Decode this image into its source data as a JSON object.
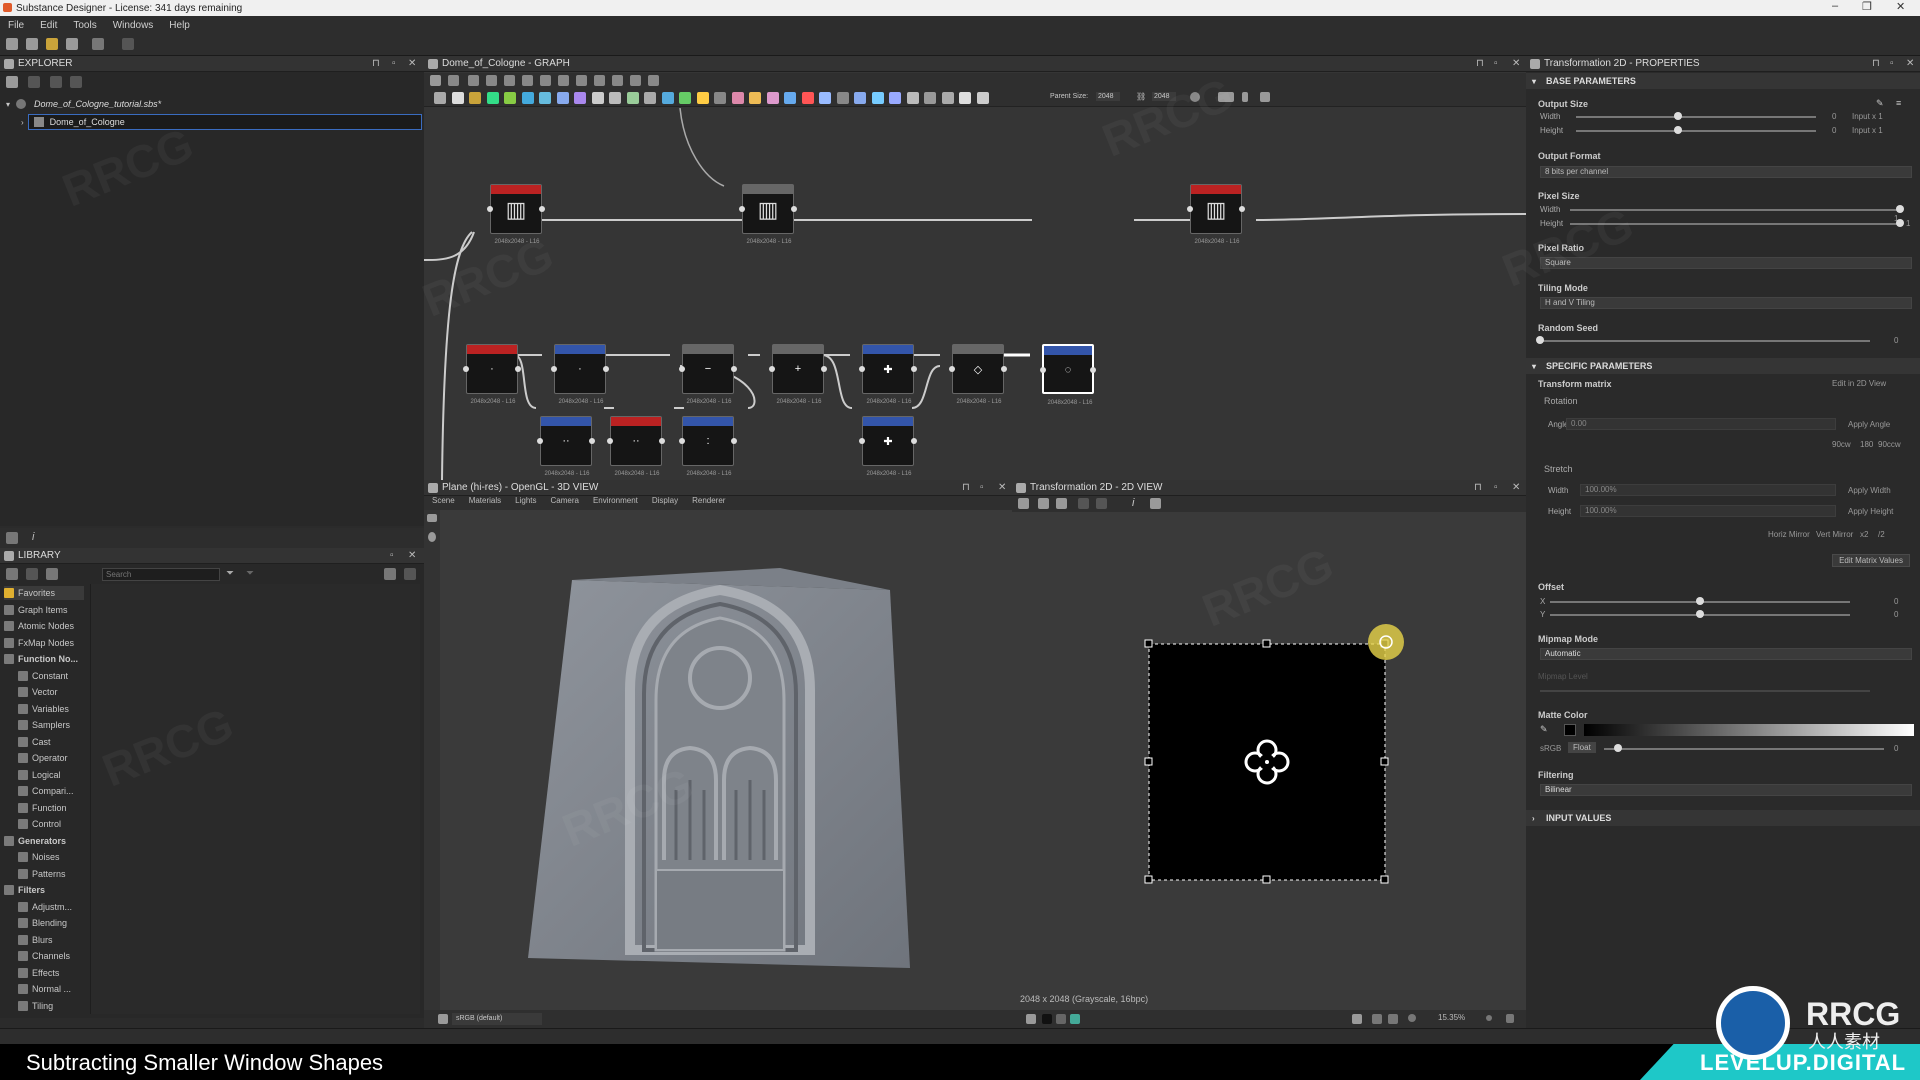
{
  "window": {
    "title": "Substance Designer - License: 341 days remaining",
    "controls": [
      "–",
      "❐",
      "✕"
    ]
  },
  "menu": [
    "File",
    "Edit",
    "Tools",
    "Windows",
    "Help"
  ],
  "explorer": {
    "title": "EXPLORER",
    "package": "Dome_of_Cologne_tutorial.sbs*",
    "graph_item": "Dome_of_Cologne"
  },
  "library": {
    "title": "LIBRARY",
    "search_placeholder": "Search",
    "categories": [
      {
        "label": "Favorites",
        "indent": 0
      },
      {
        "label": "Graph Items",
        "indent": 0
      },
      {
        "label": "Atomic Nodes",
        "indent": 0
      },
      {
        "label": "FxMap Nodes",
        "indent": 0
      },
      {
        "label": "Function No...",
        "indent": 0
      },
      {
        "label": "Constant",
        "indent": 1
      },
      {
        "label": "Vector",
        "indent": 1
      },
      {
        "label": "Variables",
        "indent": 1
      },
      {
        "label": "Samplers",
        "indent": 1
      },
      {
        "label": "Cast",
        "indent": 1
      },
      {
        "label": "Operator",
        "indent": 1
      },
      {
        "label": "Logical",
        "indent": 1
      },
      {
        "label": "Compari...",
        "indent": 1
      },
      {
        "label": "Function",
        "indent": 1
      },
      {
        "label": "Control",
        "indent": 1
      },
      {
        "label": "Generators",
        "indent": 0
      },
      {
        "label": "Noises",
        "indent": 1
      },
      {
        "label": "Patterns",
        "indent": 1
      },
      {
        "label": "Filters",
        "indent": 0
      },
      {
        "label": "Adjustm...",
        "indent": 1
      },
      {
        "label": "Blending",
        "indent": 1
      },
      {
        "label": "Blurs",
        "indent": 1
      },
      {
        "label": "Channels",
        "indent": 1
      },
      {
        "label": "Effects",
        "indent": 1
      },
      {
        "label": "Normal ...",
        "indent": 1
      },
      {
        "label": "Tiling",
        "indent": 1
      }
    ]
  },
  "graph": {
    "title": "Dome_of_Cologne - GRAPH",
    "parent_size_label": "Parent Size:",
    "parent_size_w": "2048",
    "parent_size_h": "2048",
    "node_res": "2048x2048 - L16"
  },
  "view3d": {
    "title": "Plane (hi-res) - OpenGL - 3D VIEW",
    "tabs": [
      "Scene",
      "Materials",
      "Lights",
      "Camera",
      "Environment",
      "Display",
      "Renderer"
    ],
    "colorspace": "sRGB (default)"
  },
  "view2d": {
    "title": "Transformation 2D - 2D VIEW",
    "info": "2048 x 2048 (Grayscale, 16bpc)",
    "zoom": "15.35%"
  },
  "props": {
    "title": "Transformation 2D - PROPERTIES",
    "base_section": "BASE PARAMETERS",
    "output_size": "Output Size",
    "width": "Width",
    "height": "Height",
    "output_width_value": "0",
    "output_height_value": "0",
    "output_width_mode": "Input x 1",
    "output_height_mode": "Input x 1",
    "output_format": "Output Format",
    "output_format_value": "8 bits per channel",
    "pixel_size": "Pixel Size",
    "pixel_width_value": "1",
    "pixel_height_value": "1",
    "pixel_ratio": "Pixel Ratio",
    "pixel_ratio_value": "Square",
    "tiling_mode": "Tiling Mode",
    "tiling_mode_value": "H and V Tiling",
    "random_seed": "Random Seed",
    "random_seed_value": "0",
    "specific_section": "SPECIFIC PARAMETERS",
    "transform_matrix": "Transform matrix",
    "edit_2d": "Edit in 2D View",
    "rotation": "Rotation",
    "angle": "Angle",
    "angle_value": "0.00",
    "apply_angle": "Apply Angle",
    "rot_presets": [
      "90cw",
      "180",
      "90ccw"
    ],
    "stretch": "Stretch",
    "stretch_width_value": "100.00%",
    "stretch_height_value": "100.00%",
    "apply_width": "Apply Width",
    "apply_height": "Apply Height",
    "mirror_presets": [
      "Horiz Mirror",
      "Vert Mirror",
      "x2",
      "/2"
    ],
    "edit_matrix": "Edit Matrix Values",
    "offset": "Offset",
    "x": "X",
    "y": "Y",
    "offset_x_value": "0",
    "offset_y_value": "0",
    "mipmap_mode": "Mipmap Mode",
    "mipmap_mode_value": "Automatic",
    "mipmap_level": "Mipmap Level",
    "matte_color": "Matte Color",
    "srgb": "sRGB",
    "float": "Float",
    "matte_value": "0",
    "filtering": "Filtering",
    "filtering_value": "Bilinear",
    "input_values": "INPUT VALUES"
  },
  "overlay": {
    "caption": "Subtracting Smaller Window Shapes",
    "brand": "LEVELUP.DIGITAL",
    "logo_text": "RRCG",
    "logo_sub": "人人素材"
  }
}
